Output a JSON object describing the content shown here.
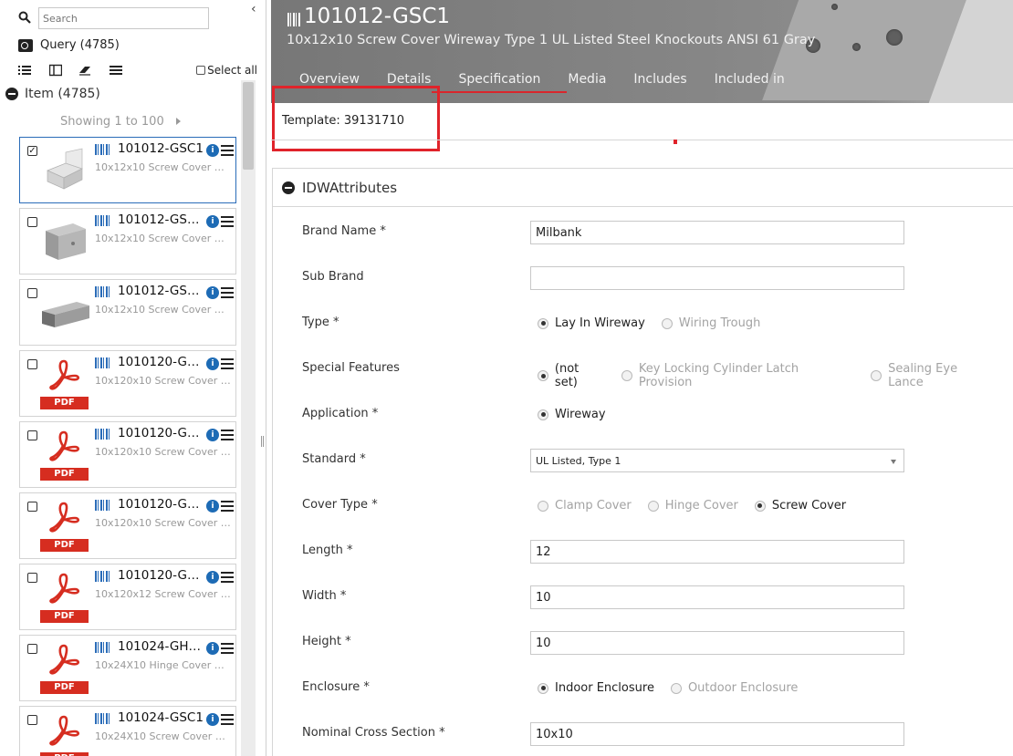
{
  "search": {
    "placeholder": "Search"
  },
  "query": {
    "label": "Query (4785)"
  },
  "toolbar": {
    "select_all": "Select all"
  },
  "item_list": {
    "header": "Item (4785)",
    "showing": "Showing 1 to 100",
    "cards": [
      {
        "title": "101012-GSC1",
        "subtitle": "10x12x10 Screw Cover Wi...",
        "thumb": "box-open",
        "checked": true
      },
      {
        "title": "101012-GSC1...",
        "subtitle": "10x12x10 Screw Cover Wi...",
        "thumb": "box",
        "checked": false
      },
      {
        "title": "101012-GSC1...",
        "subtitle": "10x12x10 Screw Cover Wi...",
        "thumb": "channel",
        "checked": false
      },
      {
        "title": "1010120-GSC1",
        "subtitle": "10x120x10 Screw Cover W...",
        "thumb": "pdf",
        "checked": false
      },
      {
        "title": "1010120-GSC...",
        "subtitle": "10x120x10 Screw Cover W...",
        "thumb": "pdf",
        "checked": false
      },
      {
        "title": "1010120-GSC...",
        "subtitle": "10x120x10 Screw Cover W...",
        "thumb": "pdf",
        "checked": false
      },
      {
        "title": "1010120-GSC...",
        "subtitle": "10x120x12 Screw Cover W...",
        "thumb": "pdf",
        "checked": false
      },
      {
        "title": "101024-GHC...",
        "subtitle": "10x24X10 Hinge Cover Wi...",
        "thumb": "pdf",
        "checked": false
      },
      {
        "title": "101024-GSC1",
        "subtitle": "10x24X10 Screw Cover Wi...",
        "thumb": "pdf",
        "checked": false
      }
    ],
    "pdf_label": "PDF"
  },
  "product": {
    "title": "101012-GSC1",
    "subtitle": "10x12x10 Screw Cover Wireway Type 1 UL Listed Steel Knockouts ANSI 61 Gray",
    "tabs": [
      "Overview",
      "Details",
      "Specification",
      "Media",
      "Includes",
      "Included in"
    ],
    "active_tab": "Specification",
    "template": "Template: 39131710"
  },
  "section": {
    "title": "IDWAttributes",
    "fields": {
      "brand_name": {
        "label": "Brand Name *",
        "value": "Milbank"
      },
      "sub_brand": {
        "label": "Sub Brand",
        "value": ""
      },
      "type": {
        "label": "Type *",
        "options": [
          "Lay In Wireway",
          "Wiring Trough"
        ],
        "selected": "Lay In Wireway"
      },
      "special_features": {
        "label": "Special Features",
        "options": [
          "(not set)",
          "Key Locking Cylinder Latch Provision",
          "Sealing Eye Lance"
        ],
        "selected": "(not set)"
      },
      "application": {
        "label": "Application *",
        "options": [
          "Wireway"
        ],
        "selected": "Wireway"
      },
      "standard": {
        "label": "Standard *",
        "value": "UL Listed, Type 1"
      },
      "cover_type": {
        "label": "Cover Type *",
        "options": [
          "Clamp Cover",
          "Hinge Cover",
          "Screw Cover"
        ],
        "selected": "Screw Cover"
      },
      "length": {
        "label": "Length *",
        "value": "12"
      },
      "width": {
        "label": "Width *",
        "value": "10"
      },
      "height": {
        "label": "Height *",
        "value": "10"
      },
      "enclosure": {
        "label": "Enclosure *",
        "options": [
          "Indoor Enclosure",
          "Outdoor Enclosure"
        ],
        "selected": "Indoor Enclosure"
      },
      "nominal_cross_section": {
        "label": "Nominal Cross Section *",
        "value": "10x10"
      }
    }
  },
  "colors": {
    "accent_red": "#e0232a",
    "info_blue": "#1d6bb5",
    "pdf_red": "#d62d20"
  }
}
